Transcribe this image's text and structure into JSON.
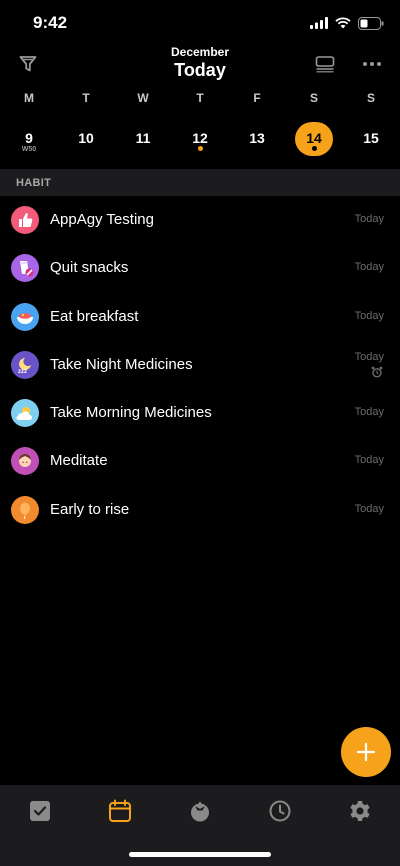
{
  "status": {
    "time": "9:42"
  },
  "header": {
    "month": "December",
    "title": "Today"
  },
  "week": [
    {
      "letter": "M",
      "num": "9",
      "sub": "W50",
      "dot": false,
      "selected": false
    },
    {
      "letter": "T",
      "num": "10",
      "sub": "",
      "dot": false,
      "selected": false
    },
    {
      "letter": "W",
      "num": "11",
      "sub": "",
      "dot": false,
      "selected": false
    },
    {
      "letter": "T",
      "num": "12",
      "sub": "",
      "dot": true,
      "selected": false
    },
    {
      "letter": "F",
      "num": "13",
      "sub": "",
      "dot": false,
      "selected": false
    },
    {
      "letter": "S",
      "num": "14",
      "sub": "",
      "dot": true,
      "selected": true
    },
    {
      "letter": "S",
      "num": "15",
      "sub": "",
      "dot": false,
      "selected": false
    }
  ],
  "section": {
    "label": "HABIT"
  },
  "habits": [
    {
      "name": "AppAgy Testing",
      "when": "Today",
      "icon": "thumbs-up-icon",
      "color": "#f25b7a"
    },
    {
      "name": "Quit snacks",
      "when": "Today",
      "icon": "no-snacks-icon",
      "color": "#a865e8"
    },
    {
      "name": "Eat breakfast",
      "when": "Today",
      "icon": "breakfast-bowl-icon",
      "color": "#4aa3f0"
    },
    {
      "name": "Take Night Medicines",
      "when": "Today",
      "icon": "sleeping-moon-icon",
      "color": "#6a52c9"
    },
    {
      "name": "Take Morning Medicines",
      "when": "Today",
      "icon": "sun-cloud-icon",
      "color": "#7fd0f0"
    },
    {
      "name": "Meditate",
      "when": "Today",
      "icon": "meditate-icon",
      "color": "#c04fb8"
    },
    {
      "name": "Early to rise",
      "when": "Today",
      "icon": "balloon-icon",
      "color": "#f28a2e"
    }
  ],
  "colors": {
    "accent": "#f7a21b",
    "background": "#000000",
    "surface": "#1c1c1e"
  }
}
